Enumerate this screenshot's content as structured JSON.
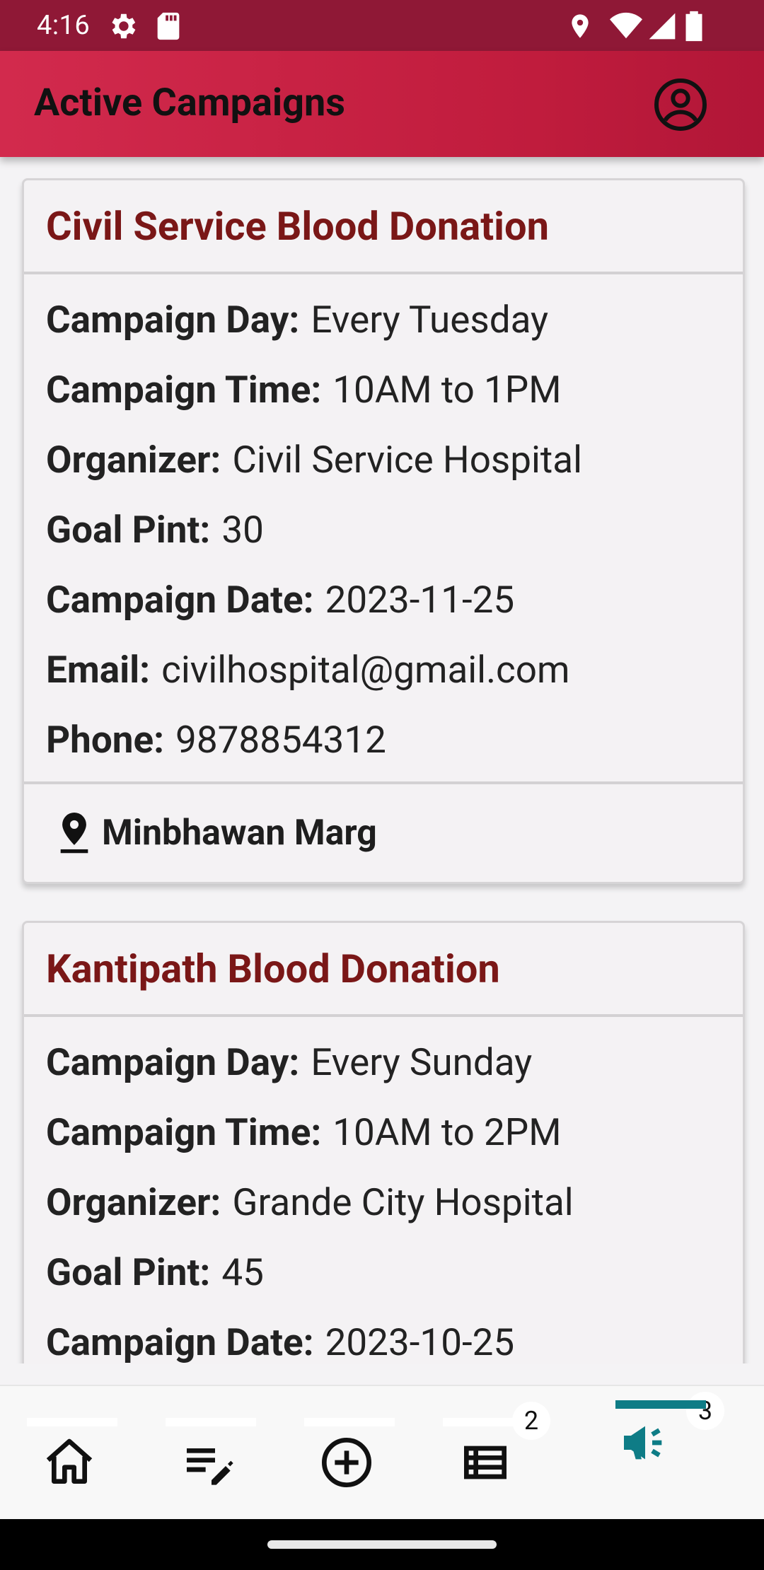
{
  "status_bar": {
    "time": "4:16"
  },
  "app_bar": {
    "title": "Active Campaigns",
    "account_icon": "account-circle-icon"
  },
  "campaigns": [
    {
      "title": "Civil Service Blood Donation",
      "fields": [
        {
          "label": "Campaign Day:",
          "value": "Every Tuesday"
        },
        {
          "label": "Campaign Time:",
          "value": "10AM to 1PM"
        },
        {
          "label": "Organizer:",
          "value": "Civil Service Hospital"
        },
        {
          "label": "Goal Pint:",
          "value": "30"
        },
        {
          "label": "Campaign Date:",
          "value": "2023-11-25"
        },
        {
          "label": "Email:",
          "value": "civilhospital@gmail.com"
        },
        {
          "label": "Phone:",
          "value": "9878854312"
        }
      ],
      "location": "Minbhawan Marg"
    },
    {
      "title": "Kantipath Blood Donation",
      "fields": [
        {
          "label": "Campaign Day:",
          "value": "Every Sunday"
        },
        {
          "label": "Campaign Time:",
          "value": "10AM to 2PM"
        },
        {
          "label": "Organizer:",
          "value": "Grande City Hospital"
        },
        {
          "label": "Goal Pint:",
          "value": "45"
        },
        {
          "label": "Campaign Date:",
          "value": "2023-10-25"
        }
      ]
    }
  ],
  "bottom_nav": {
    "items": [
      {
        "icon": "home-icon"
      },
      {
        "icon": "edit-list-icon"
      },
      {
        "icon": "add-circle-icon"
      },
      {
        "icon": "list-icon",
        "badge": "2"
      },
      {
        "icon": "campaign-megaphone-icon",
        "badge": "3",
        "active": true
      }
    ],
    "active_color": "#0e7c86"
  },
  "colors": {
    "status_bar": "#8f1836",
    "app_bar": "#c8213f",
    "card_title": "#7a1717"
  }
}
